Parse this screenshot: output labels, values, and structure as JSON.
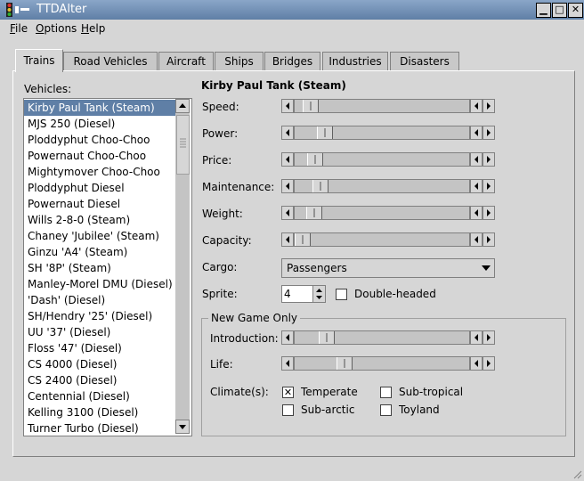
{
  "window": {
    "title": "TTDAlter"
  },
  "menu": [
    {
      "label": "File",
      "underline": "F"
    },
    {
      "label": "Options",
      "underline": "O"
    },
    {
      "label": "Help",
      "underline": "H"
    }
  ],
  "tabs": [
    {
      "label": "Trains",
      "active": true
    },
    {
      "label": "Road Vehicles",
      "active": false
    },
    {
      "label": "Aircraft",
      "active": false
    },
    {
      "label": "Ships",
      "active": false
    },
    {
      "label": "Bridges",
      "active": false
    },
    {
      "label": "Industries",
      "active": false
    },
    {
      "label": "Disasters",
      "active": false
    }
  ],
  "vehicles": {
    "label": "Vehicles:",
    "selected": 0,
    "items": [
      "Kirby Paul Tank (Steam)",
      "MJS 250 (Diesel)",
      "Ploddyphut Choo-Choo",
      "Powernaut Choo-Choo",
      "Mightymover Choo-Choo",
      "Ploddyphut Diesel",
      "Powernaut Diesel",
      "Wills 2-8-0 (Steam)",
      "Chaney 'Jubilee' (Steam)",
      "Ginzu 'A4' (Steam)",
      "SH '8P' (Steam)",
      "Manley-Morel DMU (Diesel)",
      "'Dash' (Diesel)",
      "SH/Hendry '25' (Diesel)",
      "UU '37' (Diesel)",
      "Floss '47' (Diesel)",
      "CS 4000 (Diesel)",
      "CS 2400 (Diesel)",
      "Centennial (Diesel)",
      "Kelling 3100 (Diesel)",
      "Turner Turbo (Diesel)"
    ]
  },
  "detail": {
    "vehicle_name": "Kirby Paul Tank (Steam)",
    "sliders": [
      {
        "label": "Speed:",
        "level": 0.05
      },
      {
        "label": "Power:",
        "level": 0.14
      },
      {
        "label": "Price:",
        "level": 0.08
      },
      {
        "label": "Maintenance:",
        "level": 0.11
      },
      {
        "label": "Weight:",
        "level": 0.07
      },
      {
        "label": "Capacity:",
        "level": 0.0
      }
    ],
    "cargo": {
      "label": "Cargo:",
      "value": "Passengers"
    },
    "sprite": {
      "label": "Sprite:",
      "value": "4"
    },
    "double_headed": {
      "label": "Double-headed",
      "checked": false
    }
  },
  "new_game": {
    "title": "New Game Only",
    "introduction": {
      "label": "Introduction:",
      "level": 0.15
    },
    "life": {
      "label": "Life:",
      "level": 0.26
    },
    "climates_label": "Climate(s):",
    "climates": [
      {
        "label": "Temperate",
        "checked": true
      },
      {
        "label": "Sub-tropical",
        "checked": false
      },
      {
        "label": "Sub-arctic",
        "checked": false
      },
      {
        "label": "Toyland",
        "checked": false
      }
    ]
  }
}
